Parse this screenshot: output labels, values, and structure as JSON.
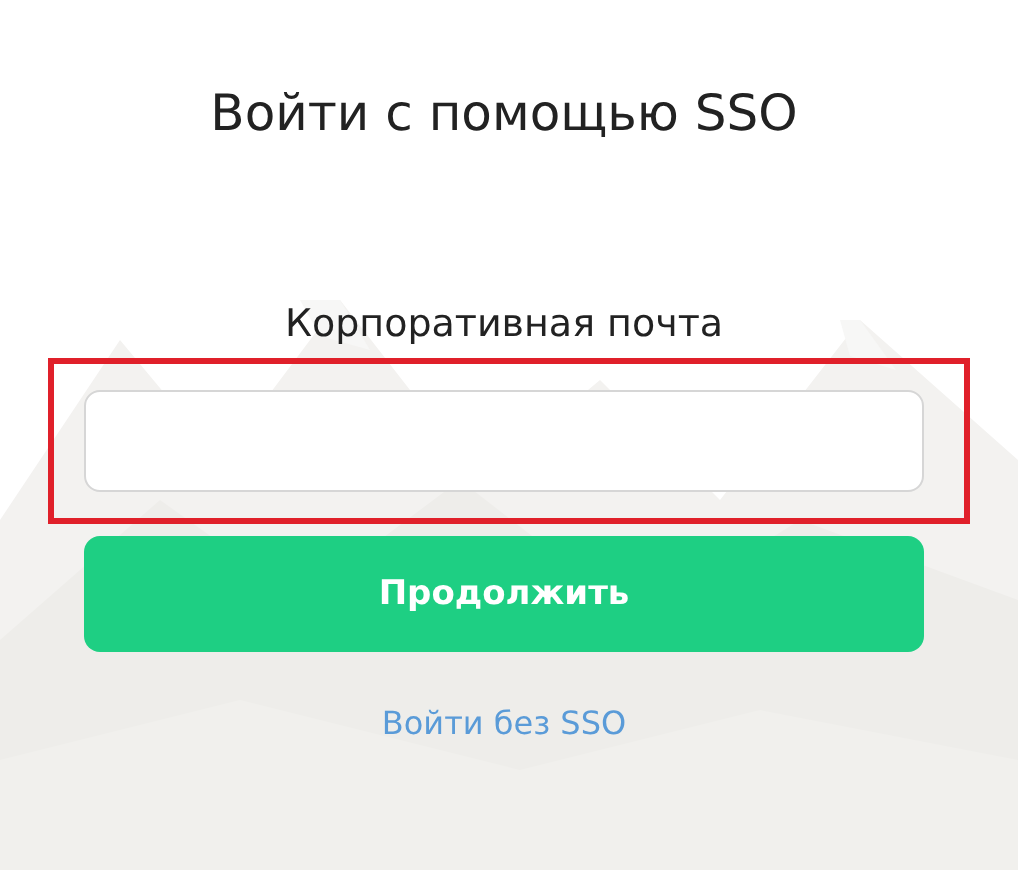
{
  "title": "Войти с помощью SSO",
  "email_field": {
    "label": "Корпоративная почта",
    "highlighted": true
  },
  "continue_button": {
    "label": "Продолжить"
  },
  "link": {
    "label": "Войти без SSO"
  }
}
